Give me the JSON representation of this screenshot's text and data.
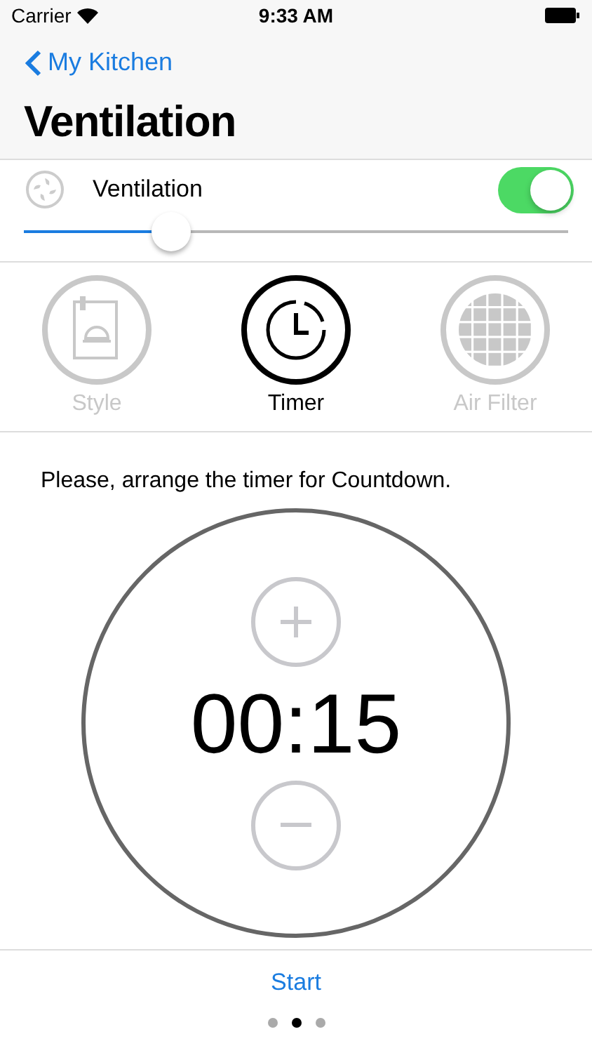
{
  "status_bar": {
    "carrier": "Carrier",
    "time": "9:33 AM"
  },
  "nav": {
    "back": "My Kitchen",
    "title": "Ventilation"
  },
  "ventilation": {
    "label": "Ventilation",
    "on": true,
    "level": 0.27
  },
  "tabs": [
    {
      "kind": "style",
      "label": "Style",
      "selected": false
    },
    {
      "kind": "timer",
      "label": "Timer",
      "selected": true
    },
    {
      "kind": "filter",
      "label": "Air Filter",
      "selected": false
    }
  ],
  "timer": {
    "instruction": "Please, arrange the timer for Countdown.",
    "value": "00:15"
  },
  "start_button": "Start",
  "pages": [
    {
      "selected": false
    },
    {
      "selected": true
    },
    {
      "selected": false
    }
  ]
}
